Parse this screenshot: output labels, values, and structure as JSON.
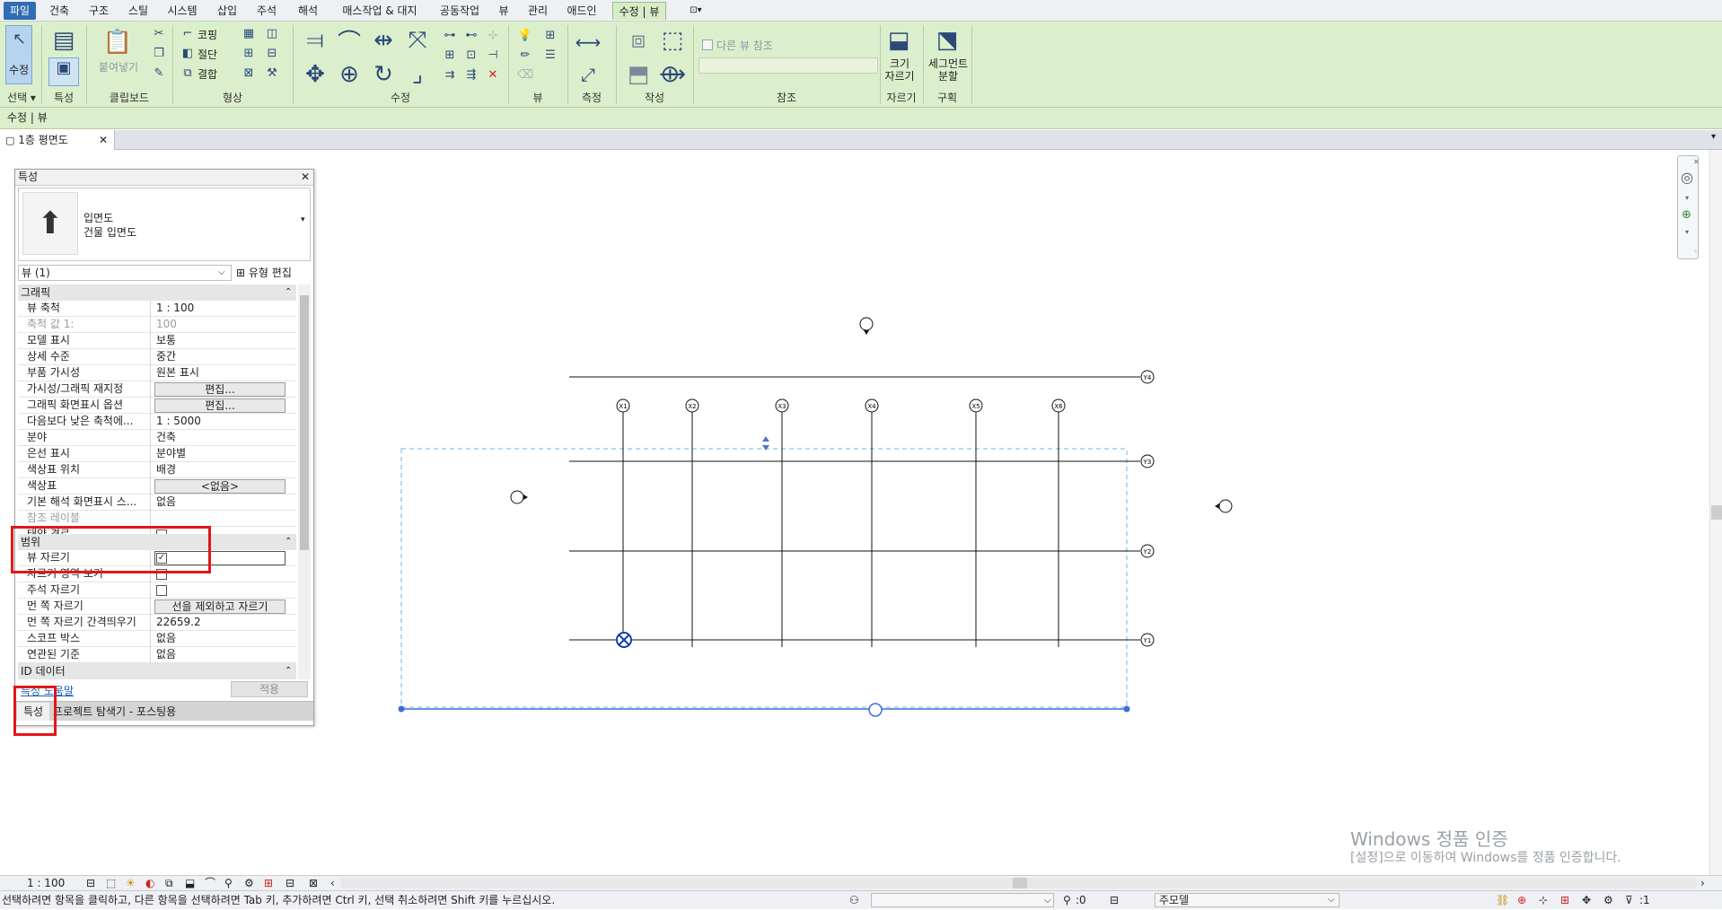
{
  "menu": {
    "tabs": [
      "파일",
      "건축",
      "구조",
      "스틸",
      "시스템",
      "삽입",
      "주석",
      "해석",
      "매스작업 & 대지",
      "공동작업",
      "뷰",
      "관리",
      "애드인",
      "수정 | 뷰"
    ],
    "active_tab": "수정 | 뷰"
  },
  "ribbon": {
    "modify_label": "수정",
    "paste_label": "붙여넣기",
    "cope_label": "코핑",
    "cut_label": "절단",
    "join_label": "결합",
    "other_view_ref": "다른 뷰 참조",
    "crop_size_label": "크기\n자르기",
    "segment_split_label": "세그먼트\n분할",
    "groups": [
      "선택",
      "특성",
      "클립보드",
      "형상",
      "수정",
      "뷰",
      "측정",
      "작성",
      "참조",
      "자르기",
      "구획"
    ],
    "select_dropdown": "선택 ▾"
  },
  "context_bar": {
    "text": "수정 | 뷰"
  },
  "view_tab": {
    "label": "1층 평면도"
  },
  "properties": {
    "title": "특성",
    "type_name_1": "입면도",
    "type_name_2": "건물 입면도",
    "selector": "뷰 (1)",
    "edit_type": "유형 편집",
    "sections": {
      "graphics": "그래픽",
      "extents": "범위",
      "identity": "ID 데이터"
    },
    "rows": [
      {
        "k": "뷰 축척",
        "v": "1 : 100"
      },
      {
        "k": "축척 값    1:",
        "v": "100"
      },
      {
        "k": "모델 표시",
        "v": "보통"
      },
      {
        "k": "상세 수준",
        "v": "중간"
      },
      {
        "k": "부품 가시성",
        "v": "원본 표시"
      },
      {
        "k": "가시성/그래픽 재지정",
        "v": "편집..."
      },
      {
        "k": "그래픽 화면표시 옵션",
        "v": "편집..."
      },
      {
        "k": "다음보다 낮은 축척에...",
        "v": "1 : 5000"
      },
      {
        "k": "분야",
        "v": "건축"
      },
      {
        "k": "은선 표시",
        "v": "분야별"
      },
      {
        "k": "색상표 위치",
        "v": "배경"
      },
      {
        "k": "색상표",
        "v": "<없음>"
      },
      {
        "k": "기본 해석 화면표시 스...",
        "v": "없음"
      },
      {
        "k": "참조 레이블",
        "v": ""
      },
      {
        "k": "태양 경로",
        "v": ""
      }
    ],
    "extent_rows": [
      {
        "k": "뷰 자르기",
        "v": ""
      },
      {
        "k": "자르기 영역 보기",
        "v": ""
      },
      {
        "k": "주석 자르기",
        "v": ""
      },
      {
        "k": "먼 쪽 자르기",
        "v": "선을 제외하고 자르기"
      },
      {
        "k": "먼 쪽 자르기 간격띄우기",
        "v": "22659.2"
      },
      {
        "k": "스코프 박스",
        "v": "없음"
      },
      {
        "k": "연관된 기준",
        "v": "없음"
      }
    ],
    "help_link": "특성 도움말",
    "apply_button": "적용",
    "bottom_tab_1": "특성",
    "bottom_tab_2": "프로젝트 탐색기 - 포스팅용"
  },
  "grid": {
    "x_labels": [
      "X1",
      "X2",
      "X3",
      "X4",
      "X5",
      "X6"
    ],
    "y_labels": [
      "Y4",
      "Y3",
      "Y2",
      "Y1"
    ]
  },
  "watermark": {
    "line1": "Windows 정품 인증",
    "line2": "[설정]으로 이동하여 Windows를 정품 인증합니다."
  },
  "view_bar": {
    "scale": "1 : 100"
  },
  "status": {
    "hint": "선택하려면 항목을 클릭하고, 다른 항목을 선택하려면 Tab 키, 추가하려면 Ctrl 키, 선택 취소하려면 Shift 키를 누르십시오.",
    "selection_count": ":0",
    "model_label": "주모델",
    "filter_count": ":1"
  }
}
